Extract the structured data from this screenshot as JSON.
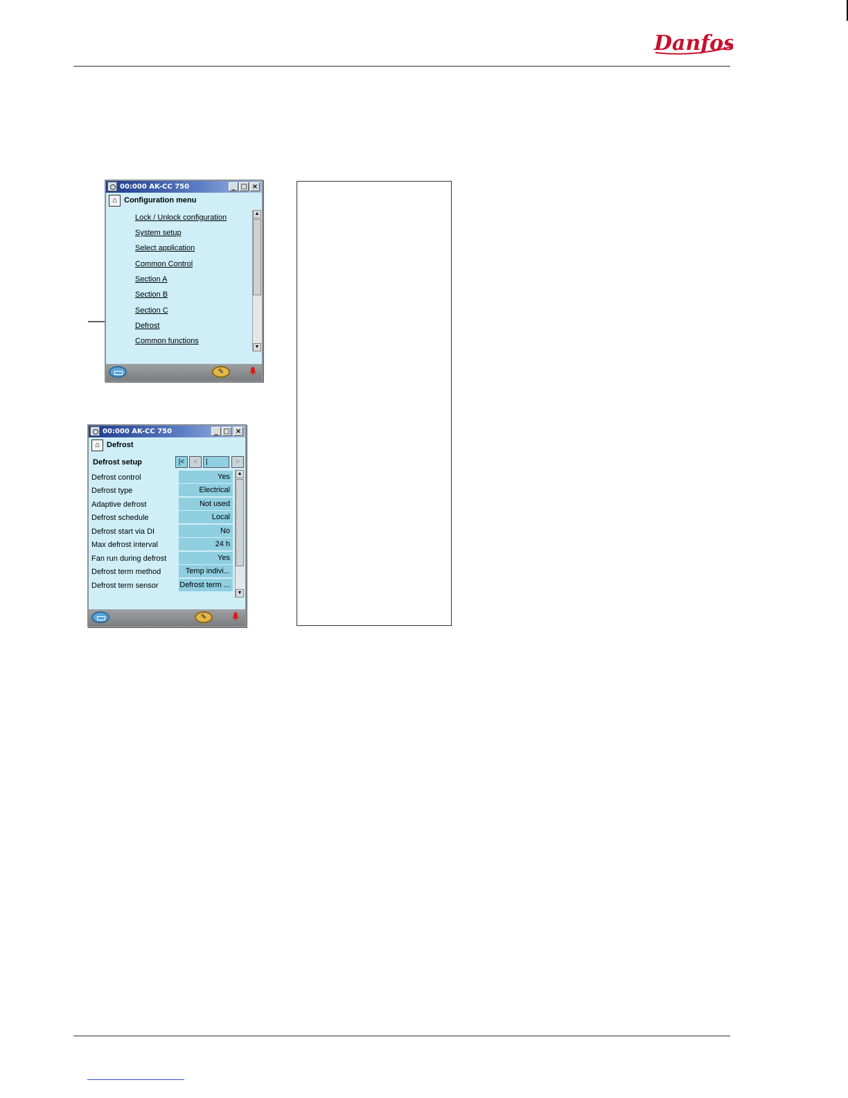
{
  "brand": {
    "logo_text": "Danfoss",
    "logo_color": "#c8102e"
  },
  "config_window": {
    "title": "00:000 AK-CC 750",
    "header": "Configuration menu",
    "items": [
      "Lock / Unlock configuration",
      "System setup",
      "Select application",
      "Common Control",
      "Section A",
      "Section B",
      "Section C",
      "Defrost",
      "Common functions"
    ]
  },
  "defrost_window": {
    "title": "00:000 AK-CC 750",
    "header": "Defrost",
    "setup_title": "Defrost setup",
    "nav": {
      "first": "|<",
      "prev": "<",
      "page": "|",
      "next": ">"
    },
    "rows": [
      {
        "label": "Defrost control",
        "value": "Yes"
      },
      {
        "label": "Defrost type",
        "value": "Electrical"
      },
      {
        "label": "Adaptive defrost",
        "value": "Not used"
      },
      {
        "label": "Defrost schedule",
        "value": "Local"
      },
      {
        "label": "Defrost start via DI",
        "value": "No"
      },
      {
        "label": "Max defrost interval",
        "value": "24 h"
      },
      {
        "label": "Fan run during defrost",
        "value": "Yes"
      },
      {
        "label": "Defrost term method",
        "value": "Temp indivi..."
      },
      {
        "label": "Defrost term sensor",
        "value": "Defrost term ..."
      }
    ]
  },
  "icons": {
    "app": "app-icon",
    "home": "home-icon",
    "minimize": "minimize-icon",
    "maximize": "maximize-icon",
    "close": "close-icon",
    "display": "display-icon",
    "wrench": "wrench-icon",
    "alarm": "alarm-bell-icon"
  }
}
